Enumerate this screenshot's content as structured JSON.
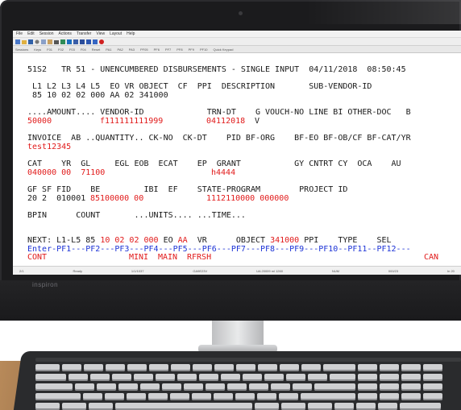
{
  "device": {
    "brand": "inspiron"
  },
  "menubar": [
    "File",
    "Edit",
    "Session",
    "Actions",
    "Transfer",
    "View",
    "Layout",
    "Help"
  ],
  "toolbar2": [
    "Sessions",
    "Keys",
    "F01",
    "F02",
    "F03",
    "F04",
    "Reset",
    "PA1",
    "PA2",
    "PA3",
    "PF05",
    "PF6",
    "PF7",
    "PF8",
    "PF9",
    "PF10",
    "Quick Keypad"
  ],
  "screen": {
    "header": "51S2   TR 51 - UNENCUMBERED DISBURSEMENTS - SINGLE INPUT  04/11/2018  08:50:45",
    "row1_labels": " L1 L2 L3 L4 L5  EO VR OBJECT  CF  PPI  DESCRIPTION       SUB-VENDOR-ID",
    "row1_values": " 85 10 02 02 000 AA 02 341000",
    "row2_labels": "....AMOUNT.... VENDOR-ID             TRN-DT    G VOUCH-NO LINE BI OTHER-DOC   B",
    "row2_amount": "50000",
    "row2_vendor": "f111111111999",
    "row2_trndt": "04112018",
    "row2_v": "V",
    "row3_labels": "INVOICE  AB ..QUANTITY.. CK-NO  CK-DT    PID BF-ORG    BF-EO BF-OB/CF BF-CAT/YR",
    "row3_invoice": "test12345",
    "row4_labels": "CAT    YR  GL     EGL EOB  ECAT    EP  GRANT           GY CNTRT CY  OCA    AU",
    "row4_cat": "040000 00  71100",
    "row4_grant": "h4444",
    "row5_labels": "GF SF FID    BE         IBI  EF    STATE-PROGRAM        PROJECT ID",
    "row5_gf": "20 2  010001",
    "row5_be": "85100000 00",
    "row5_state": "1112110000 000000",
    "row6_labels": "BPIN      COUNT       ...UNITS.... ...TIME...",
    "next_prefix": "NEXT: L1-L5 85 ",
    "next_l2": "10 02 02 000",
    "next_eo_label": " EO ",
    "next_eo": "AA",
    "next_vr_label": "  VR      OBJECT ",
    "next_object": "341000",
    "next_tail": " PPI    TYPE    SEL",
    "pf_line": "Enter-PF1---PF2---PF3---PF4---PF5---PF6---PF7---PF8---PF9---PF10--PF11--PF12---",
    "pf_cont": "CONT",
    "pf_mini": "MINI",
    "pf_main": "MAIN",
    "pf_rfrsh": "RFRSH",
    "pf_can": "CAN"
  },
  "statusbar": [
    "2/1",
    "Ready",
    "1/1/1037",
    "GA9E23V",
    "UA 20009 ml 1260",
    "NUM",
    "000/23",
    "In 20"
  ]
}
